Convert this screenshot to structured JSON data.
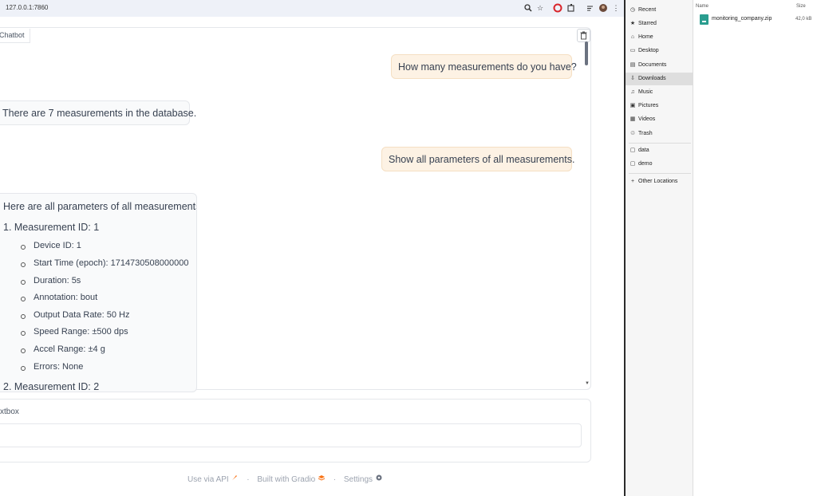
{
  "browser": {
    "url": "127.0.0.1:7860",
    "toolbar_icons": [
      "zoom-icon",
      "star-icon",
      "opera-icon",
      "extensions-icon",
      "media-icon",
      "profile-avatar",
      "menu-icon"
    ]
  },
  "chatbot": {
    "label": "Chatbot",
    "messages": [
      {
        "role": "user",
        "text": "How many measurements do you have?"
      },
      {
        "role": "bot",
        "text": "There are 7 measurements in the database."
      },
      {
        "role": "user",
        "text": "Show all parameters of all measurements."
      },
      {
        "role": "bot",
        "intro": "Here are all parameters of all measurements:",
        "item1_title": "1. Measurement ID: 1",
        "item1_params": [
          "Device ID: 1",
          "Start Time (epoch): 1714730508000000",
          "Duration: 5s",
          "Annotation: bout",
          "Output Data Rate: 50 Hz",
          "Speed Range: ±500 dps",
          "Accel Range: ±4 g",
          "Errors: None"
        ],
        "item2_title": "2. Measurement ID: 2"
      }
    ]
  },
  "textbox": {
    "label": "xtbox",
    "value": ""
  },
  "footer": {
    "api": "Use via API",
    "built": "Built with Gradio",
    "settings": "Settings",
    "sep": "·"
  },
  "file_manager": {
    "sidebar": [
      {
        "label": "Recent",
        "icon": "clock-icon"
      },
      {
        "label": "Starred",
        "icon": "star-icon"
      },
      {
        "label": "Home",
        "icon": "home-icon"
      },
      {
        "label": "Desktop",
        "icon": "desktop-icon"
      },
      {
        "label": "Documents",
        "icon": "document-icon"
      },
      {
        "label": "Downloads",
        "icon": "download-icon",
        "active": true
      },
      {
        "label": "Music",
        "icon": "music-icon"
      },
      {
        "label": "Pictures",
        "icon": "picture-icon"
      },
      {
        "label": "Videos",
        "icon": "video-icon"
      },
      {
        "label": "Trash",
        "icon": "trash-icon"
      },
      {
        "label": "data",
        "icon": "folder-icon"
      },
      {
        "label": "demo",
        "icon": "folder-icon"
      },
      {
        "label": "Other Locations",
        "icon": "plus-icon"
      }
    ],
    "columns": {
      "name": "Name",
      "size": "Size"
    },
    "files": [
      {
        "name": "monitoring_company.zip",
        "size": "42,0 kB"
      }
    ]
  }
}
